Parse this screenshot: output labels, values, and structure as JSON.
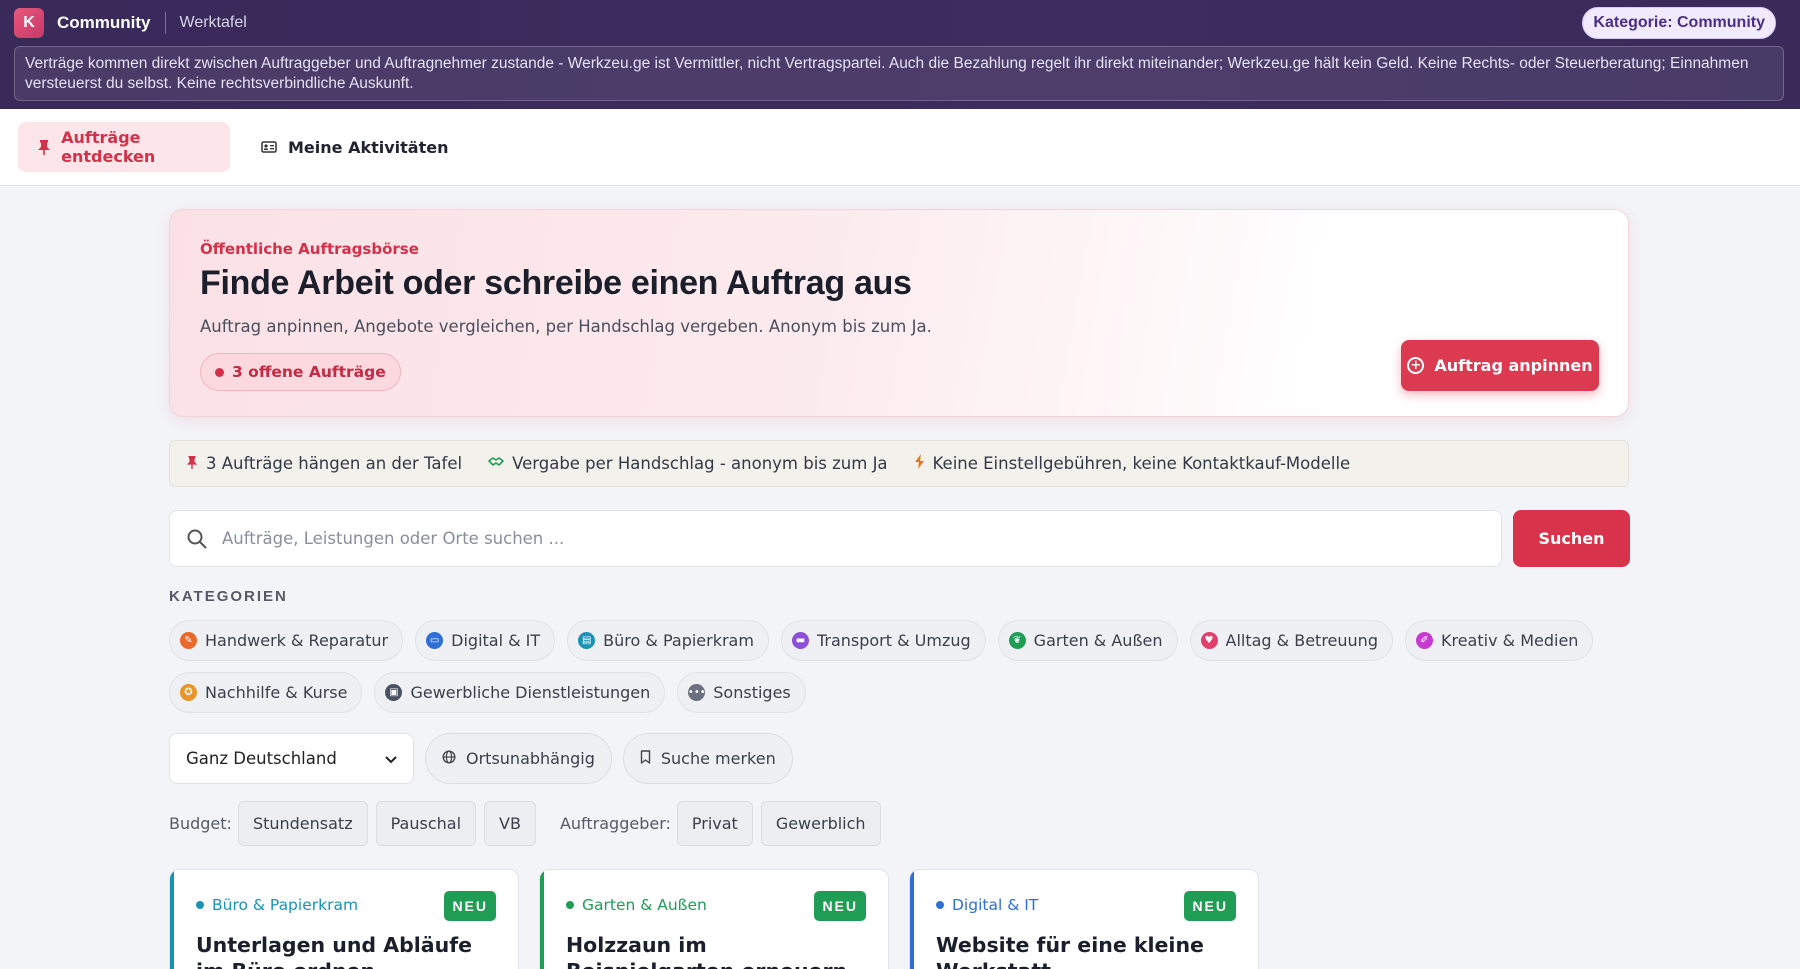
{
  "header": {
    "logo_letter": "K",
    "app_name": "Community",
    "subtitle": "Werktafel",
    "category_badge": "Kategorie: Community",
    "disclaimer": "Verträge kommen direkt zwischen Auftraggeber und Auftragnehmer zustande - Werkzeu.ge ist Vermittler, nicht Vertragspartei. Auch die Bezahlung regelt ihr direkt miteinander; Werkzeu.ge hält kein Geld. Keine Rechts- oder Steuerberatung; Einnahmen versteuerst du selbst. Keine rechtsverbindliche Auskunft."
  },
  "nav": {
    "tabs": [
      {
        "label": "Aufträge entdecken",
        "icon": "pin-icon",
        "active": true
      },
      {
        "label": "Meine Aktivitäten",
        "icon": "id-card-icon",
        "active": false
      }
    ]
  },
  "hero": {
    "kicker": "Öffentliche Auftragsbörse",
    "title": "Finde Arbeit oder schreibe einen Auftrag aus",
    "subtitle": "Auftrag anpinnen, Angebote vergleichen, per Handschlag vergeben. Anonym bis zum Ja.",
    "open_count_label": "3 offene Aufträge",
    "cta_label": "Auftrag anpinnen"
  },
  "stats": [
    {
      "icon": "pin-icon",
      "text": "3 Aufträge hängen an der Tafel",
      "color": "#d3314a"
    },
    {
      "icon": "handshake-icon",
      "text": "Vergabe per Handschlag - anonym bis zum Ja",
      "color": "#1f9d55"
    },
    {
      "icon": "lightning-icon",
      "text": "Keine Einstellgebühren, keine Kontaktkauf-Modelle",
      "color": "#e0781f"
    }
  ],
  "search": {
    "placeholder": "Aufträge, Leistungen oder Orte suchen ...",
    "value": "",
    "button_label": "Suchen"
  },
  "categories": {
    "label": "KATEGORIEN",
    "row1": [
      {
        "label": "Handwerk & Reparatur",
        "color": "#e8692a"
      },
      {
        "label": "Digital & IT",
        "color": "#2f6fd6"
      },
      {
        "label": "Büro & Papierkram",
        "color": "#1893b5"
      },
      {
        "label": "Transport & Umzug",
        "color": "#8b4fd8"
      },
      {
        "label": "Garten & Außen",
        "color": "#1f9d55"
      },
      {
        "label": "Alltag & Betreuung",
        "color": "#e0406b"
      },
      {
        "label": "Kreativ & Medien",
        "color": "#c73ad0"
      }
    ],
    "row2": [
      {
        "label": "Nachhilfe & Kurse",
        "color": "#e8962a"
      },
      {
        "label": "Gewerbliche Dienstleistungen",
        "color": "#4a5262"
      },
      {
        "label": "Sonstiges",
        "color": "#6b7080"
      }
    ]
  },
  "filters": {
    "region_selected": "Ganz Deutschland",
    "remote_label": "Ortsunabhängig",
    "save_search_label": "Suche merken",
    "budget_label": "Budget:",
    "budget_options": [
      "Stundensatz",
      "Pauschal",
      "VB"
    ],
    "client_label": "Auftraggeber:",
    "client_options": [
      "Privat",
      "Gewerblich"
    ]
  },
  "listings": [
    {
      "category": "Büro & Papierkram",
      "color": "#1893b5",
      "badge": "NEU",
      "title": "Unterlagen und Abläufe im Büro ordnen"
    },
    {
      "category": "Garten & Außen",
      "color": "#1f9d55",
      "badge": "NEU",
      "title": "Holzzaun im Beispielgarten erneuern"
    },
    {
      "category": "Digital & IT",
      "color": "#2f6fd6",
      "badge": "NEU",
      "title": "Website für eine kleine Werkstatt"
    }
  ]
}
